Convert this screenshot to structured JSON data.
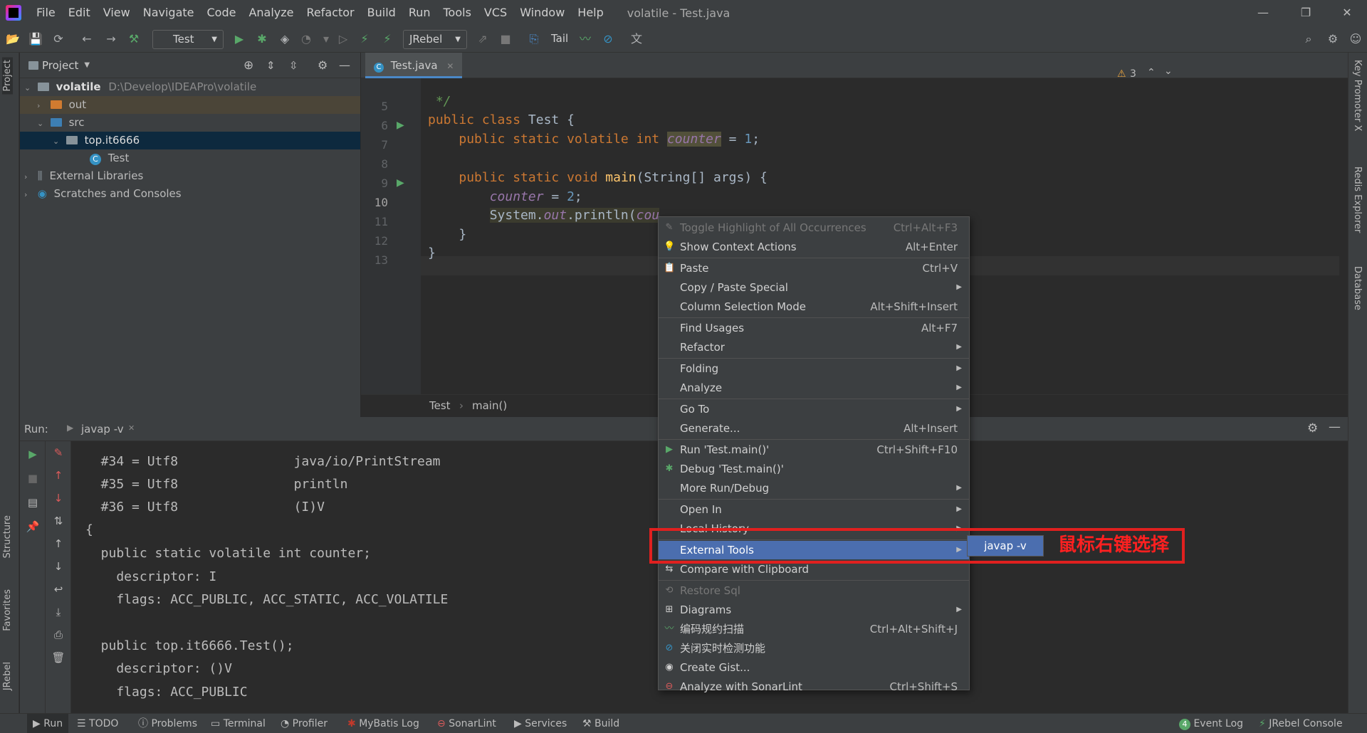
{
  "menubar": {
    "items": [
      "File",
      "Edit",
      "View",
      "Navigate",
      "Code",
      "Analyze",
      "Refactor",
      "Build",
      "Run",
      "Tools",
      "VCS",
      "Window",
      "Help"
    ],
    "window_title": "volatile - Test.java"
  },
  "toolbar": {
    "run_config": "Test",
    "jrebel": "JRebel",
    "tail": "Tail"
  },
  "project": {
    "title": "Project",
    "root_name": "volatile",
    "root_path": "D:\\Develop\\IDEAPro\\volatile",
    "items": [
      "out",
      "src",
      "top.it6666",
      "Test",
      "External Libraries",
      "Scratches and Consoles"
    ]
  },
  "editor": {
    "tab": "Test.java",
    "warnings": "3",
    "line_numbers": [
      "5",
      "6",
      "7",
      "8",
      "9",
      "10",
      "11",
      "12",
      "13"
    ],
    "breadcrumb": [
      "Test",
      "main()"
    ],
    "colors": {
      "keyword": "#cc7832",
      "field": "#9876aa",
      "number": "#6897bb",
      "function": "#ffc66d",
      "comment": "#629755"
    }
  },
  "run": {
    "label": "Run:",
    "tab": "javap -v",
    "output": [
      "  #34 = Utf8               java/io/PrintStream",
      "  #35 = Utf8               println",
      "  #36 = Utf8               (I)V",
      "{",
      "  public static volatile int counter;",
      "    descriptor: I",
      "    flags: ACC_PUBLIC, ACC_STATIC, ACC_VOLATILE",
      "",
      "  public top.it6666.Test();",
      "    descriptor: ()V",
      "    flags: ACC_PUBLIC"
    ]
  },
  "context_menu": {
    "items": [
      {
        "label": "Toggle Highlight of All Occurrences",
        "shortcut": "Ctrl+Alt+F3",
        "disabled": true
      },
      {
        "label": "Show Context Actions",
        "shortcut": "Alt+Enter"
      },
      {
        "label": "Paste",
        "shortcut": "Ctrl+V"
      },
      {
        "label": "Copy / Paste Special",
        "shortcut": ""
      },
      {
        "label": "Column Selection Mode",
        "shortcut": "Alt+Shift+Insert"
      },
      {
        "label": "Find Usages",
        "shortcut": "Alt+F7"
      },
      {
        "label": "Refactor",
        "shortcut": ""
      },
      {
        "label": "Folding",
        "shortcut": ""
      },
      {
        "label": "Analyze",
        "shortcut": ""
      },
      {
        "label": "Go To",
        "shortcut": ""
      },
      {
        "label": "Generate...",
        "shortcut": "Alt+Insert"
      },
      {
        "label": "Run 'Test.main()'",
        "shortcut": "Ctrl+Shift+F10"
      },
      {
        "label": "Debug 'Test.main()'",
        "shortcut": ""
      },
      {
        "label": "More Run/Debug",
        "shortcut": ""
      },
      {
        "label": "Open In",
        "shortcut": ""
      },
      {
        "label": "Local History",
        "shortcut": ""
      },
      {
        "label": "External Tools",
        "shortcut": ""
      },
      {
        "label": "Compare with Clipboard",
        "shortcut": ""
      },
      {
        "label": "Restore Sql",
        "shortcut": "",
        "disabled": true
      },
      {
        "label": "Diagrams",
        "shortcut": ""
      },
      {
        "label": "编码规约扫描",
        "shortcut": "Ctrl+Alt+Shift+J"
      },
      {
        "label": "关闭实时检测功能",
        "shortcut": ""
      },
      {
        "label": "Create Gist...",
        "shortcut": ""
      },
      {
        "label": "Analyze with SonarLint",
        "shortcut": "Ctrl+Shift+S"
      }
    ],
    "submenu_item": "javap -v",
    "annotation": "鼠标右键选择",
    "highlight_color": "#4b6eaf",
    "annotation_color": "#e0201f"
  },
  "left_tabs": [
    "Project",
    "Structure",
    "Favorites",
    "JRebel"
  ],
  "right_tabs": [
    "Key Promoter X",
    "Redis Explorer",
    "Database"
  ],
  "statusbar": {
    "left": [
      "Run",
      "TODO",
      "Problems",
      "Terminal",
      "Profiler",
      "MyBatis Log",
      "SonarLint",
      "Services",
      "Build"
    ],
    "event_count": "4",
    "right": [
      "Event Log",
      "JRebel Console"
    ]
  }
}
